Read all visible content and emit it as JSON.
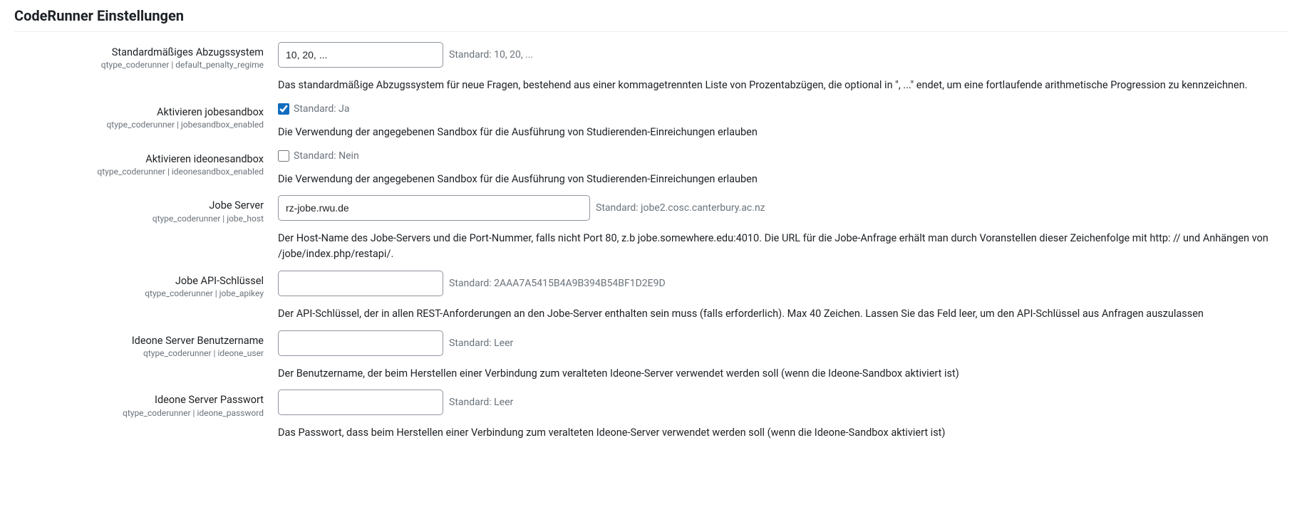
{
  "page_title": "CodeRunner Einstellungen",
  "settings": {
    "penalty": {
      "label": "Standardmäßiges Abzugssystem",
      "sublabel": "qtype_coderunner | default_penalty_regime",
      "value": "10, 20, ...",
      "default": "Standard: 10, 20, ...",
      "desc": "Das standardmäßige Abzugssystem für neue Fragen, bestehend aus einer kommagetrennten Liste von Prozentabzügen, die optional in \", ...\" endet, um eine fortlaufende arithmetische Progression zu kennzeichnen."
    },
    "jobesandbox": {
      "label": "Aktivieren jobesandbox",
      "sublabel": "qtype_coderunner | jobesandbox_enabled",
      "default": "Standard: Ja",
      "desc": "Die Verwendung der angegebenen Sandbox für die Ausführung von Studierenden-Einreichungen erlauben"
    },
    "ideonesandbox": {
      "label": "Aktivieren ideonesandbox",
      "sublabel": "qtype_coderunner | ideonesandbox_enabled",
      "default": "Standard: Nein",
      "desc": "Die Verwendung der angegebenen Sandbox für die Ausführung von Studierenden-Einreichungen erlauben"
    },
    "jobehost": {
      "label": "Jobe Server",
      "sublabel": "qtype_coderunner | jobe_host",
      "value": "rz-jobe.rwu.de",
      "default": "Standard: jobe2.cosc.canterbury.ac.nz",
      "desc": "Der Host-Name des Jobe-Servers und die Port-Nummer, falls nicht Port 80, z.b jobe.somewhere.edu:4010. Die URL für die Jobe-Anfrage erhält man durch Voranstellen dieser Zeichenfolge mit http: // und Anhängen von /jobe/index.php/restapi/."
    },
    "jobeapikey": {
      "label": "Jobe API-Schlüssel",
      "sublabel": "qtype_coderunner | jobe_apikey",
      "value": "",
      "default": "Standard: 2AAA7A5415B4A9B394B54BF1D2E9D",
      "desc": "Der API-Schlüssel, der in allen REST-Anforderungen an den Jobe-Server enthalten sein muss (falls erforderlich). Max 40 Zeichen. Lassen Sie das Feld leer, um den API-Schlüssel aus Anfragen auszulassen"
    },
    "ideoneuser": {
      "label": "Ideone Server Benutzername",
      "sublabel": "qtype_coderunner | ideone_user",
      "value": "",
      "default": "Standard: Leer",
      "desc": "Der Benutzername, der beim Herstellen einer Verbindung zum veralteten Ideone-Server verwendet werden soll (wenn die Ideone-Sandbox aktiviert ist)"
    },
    "ideonepass": {
      "label": "Ideone Server Passwort",
      "sublabel": "qtype_coderunner | ideone_password",
      "value": "",
      "default": "Standard: Leer",
      "desc": "Das Passwort, dass beim Herstellen einer Verbindung zum veralteten Ideone-Server verwendet werden soll (wenn die Ideone-Sandbox aktiviert ist)"
    }
  }
}
